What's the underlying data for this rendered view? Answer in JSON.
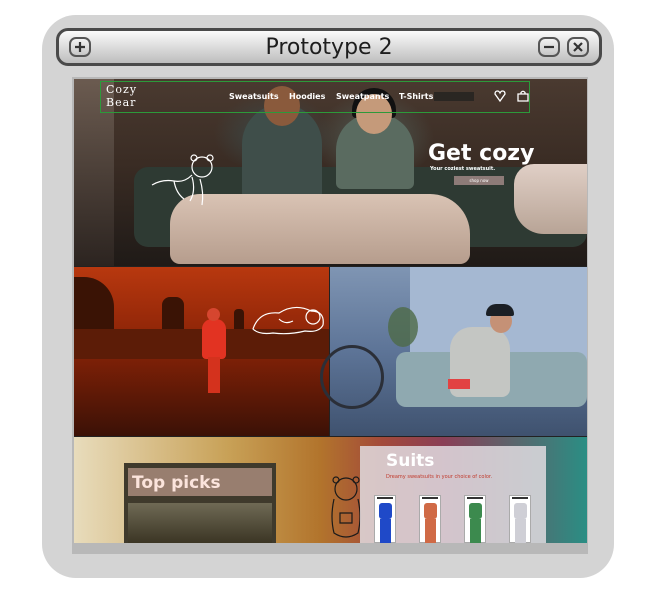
{
  "window": {
    "title": "Prototype 2",
    "add_icon": "plus-icon",
    "minimize_icon": "minus-icon",
    "close_icon": "close-icon"
  },
  "nav": {
    "logo": {
      "line1": "Cozy",
      "line2": "Bear"
    },
    "items": [
      {
        "label": "Sweatsuits"
      },
      {
        "label": "Hoodies"
      },
      {
        "label": "Sweatpants"
      },
      {
        "label": "T-Shirts"
      }
    ],
    "icons": [
      "heart-icon",
      "shopping-bag-icon"
    ]
  },
  "hero": {
    "title": "Get cozy",
    "subtitle": "Your coziest sweatsuit.",
    "button": "shop now"
  },
  "sections": {
    "top_picks": {
      "title": "Top picks"
    },
    "suits": {
      "title": "Suits",
      "subtitle": "Dreamy sweatsuits in your choice of color.",
      "products": [
        {
          "color": "#1f49c8"
        },
        {
          "color": "#d06a46"
        },
        {
          "color": "#3c8a4e"
        },
        {
          "color": "#cfcfd6"
        }
      ]
    }
  },
  "colors": {
    "frame": "#d4d4d4",
    "nav_outline": "#2c9a3a",
    "hero_button": "#8d7b78",
    "suits_subtitle": "#c0392b"
  }
}
